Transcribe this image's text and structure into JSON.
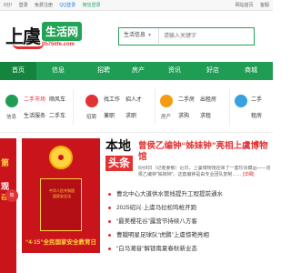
{
  "topbar": {
    "welcome": "0分!",
    "login": "登录",
    "register": "免费注册",
    "qq_login": "QQ登录",
    "wechat_login": "微信登录",
    "right": [
      "网站首页",
      "客服"
    ]
  },
  "logo": {
    "brush_text": "上虞",
    "badge_text": "生活网",
    "url": "0575life.com"
  },
  "search": {
    "category": "生活信息",
    "placeholder": "请输入关键字"
  },
  "nav": [
    {
      "label": "首页",
      "active": true
    },
    {
      "label": "信息",
      "active": false
    },
    {
      "label": "招聘",
      "active": false
    },
    {
      "label": "房产",
      "active": false
    },
    {
      "label": "资讯",
      "active": false
    },
    {
      "label": "好店",
      "active": false
    },
    {
      "label": "商城",
      "active": false
    }
  ],
  "categories": {
    "info": {
      "label": "信息",
      "links": [
        "二手市场",
        "顺风车",
        "生活服务",
        "二手车"
      ]
    },
    "jobs": {
      "label": "招聘",
      "links": [
        "找工作",
        "招人才",
        "兼职",
        "求职"
      ]
    },
    "house": {
      "label": "房产",
      "links": [
        "二手房",
        "出租房",
        "求购",
        "求租"
      ]
    },
    "more": {
      "label": "",
      "links": [
        "二手",
        "租房"
      ]
    }
  },
  "banner": {
    "left_lines": [
      "第",
      "观",
      "召开"
    ],
    "poster_title_lines": [
      "中华人民共和国",
      "国家安全法"
    ],
    "poster_slogan": "“4·15”全民国家安全教育日",
    "badge": "热"
  },
  "news": {
    "label_a": "本地",
    "label_b": "头条",
    "headline": "曾侯乙编钟“姊妹钟”亮相上虞博物馆",
    "summary": "8月8日（记者姜敏）近日，上虞博物馆迎来了一套珍贵藏品——曾侯乙编钟“姊妹钟”。这套编钟是由专业团队复制……",
    "summary_more": "[详细]",
    "items": [
      "曹北中心大道供水管线提升工程提前通水",
      "2025绍兴·上虞马拉松鸣枪开跑",
      "“最美樱花谷”露营节持续八方客",
      "曹娥明星足球队“虎鹏”上虞惊艳亮相",
      "“白马潮音”解锁南夏春秋新业态"
    ]
  },
  "colors": {
    "brand_green": "#1f9d55",
    "accent_red": "#e23232"
  }
}
